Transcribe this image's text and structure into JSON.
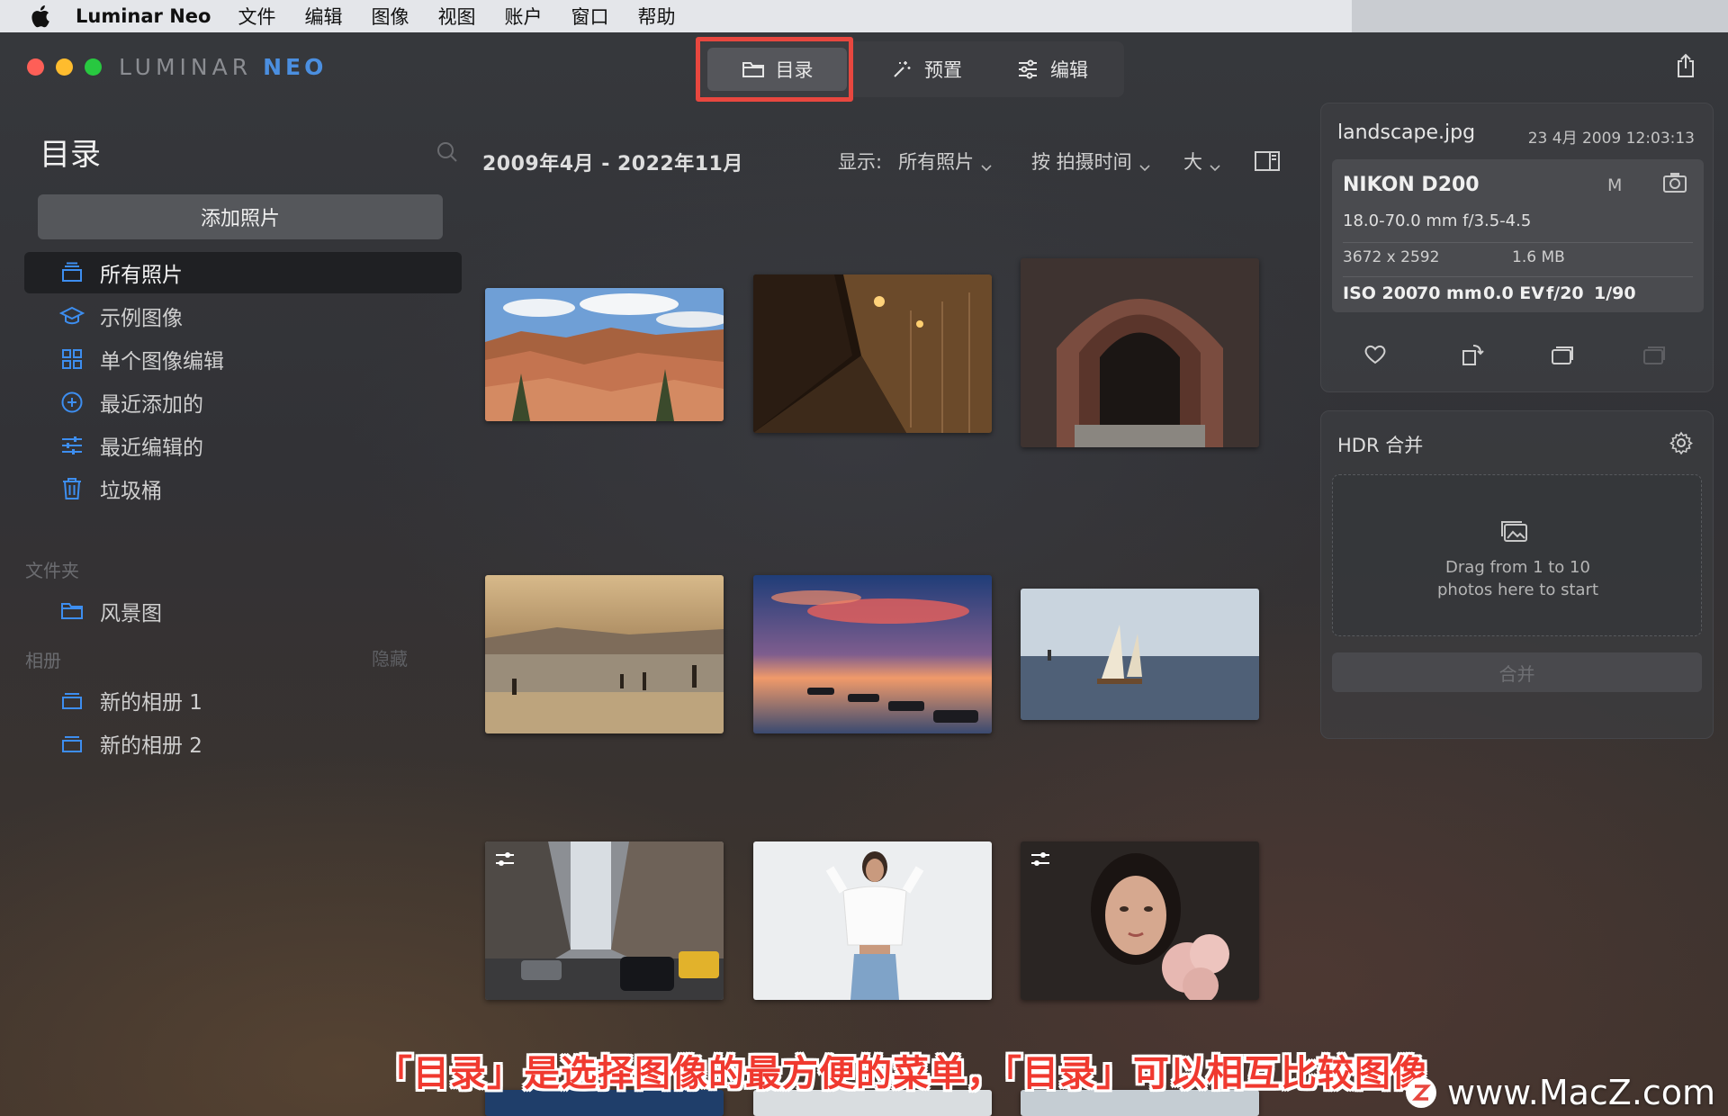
{
  "menubar": {
    "app_name": "Luminar Neo",
    "items": [
      "文件",
      "编辑",
      "图像",
      "视图",
      "账户",
      "窗口",
      "帮助"
    ]
  },
  "brand": {
    "part1": "LUMINAR",
    "part2": "NEO"
  },
  "mode_tabs": {
    "catalog": "目录",
    "presets": "预置",
    "edit": "编辑"
  },
  "sidebar": {
    "title": "目录",
    "add_photos": "添加照片",
    "items": [
      {
        "label": "所有照片",
        "icon": "stack-icon"
      },
      {
        "label": "示例图像",
        "icon": "graduation-cap-icon"
      },
      {
        "label": "单个图像编辑",
        "icon": "grid-icon"
      },
      {
        "label": "最近添加的",
        "icon": "plus-circle-icon"
      },
      {
        "label": "最近编辑的",
        "icon": "sliders-icon"
      },
      {
        "label": "垃圾桶",
        "icon": "trash-icon"
      }
    ],
    "folders_label": "文件夹",
    "folders": [
      {
        "label": "风景图",
        "icon": "folder-icon"
      }
    ],
    "albums_label": "相册",
    "albums_hide": "隐藏",
    "albums": [
      {
        "label": "新的相册 1",
        "icon": "album-icon"
      },
      {
        "label": "新的相册 2",
        "icon": "album-icon"
      }
    ]
  },
  "grid": {
    "date_range": "2009年4月 - 2022年11月",
    "show_label": "显示:",
    "show_value": "所有照片",
    "sort_value": "按 拍摄时间",
    "size_value": "大"
  },
  "info": {
    "filename": "landscape.jpg",
    "date": "23 4月 2009 12:03:13",
    "camera": "NIKON D200",
    "mode": "M",
    "lens": "18.0-70.0 mm f/3.5-4.5",
    "resolution": "3672 x 2592",
    "size": "1.6 MB",
    "iso": "ISO 200",
    "focal": "70 mm",
    "ev": "0.0 EV",
    "aperture": "f/20",
    "shutter": "1/90"
  },
  "hdr": {
    "title": "HDR 合并",
    "drop_line1": "Drag from 1 to 10",
    "drop_line2": "photos here to start",
    "merge": "合并"
  },
  "overlay": {
    "subtitle": "「目录」是选择图像的最方便的菜单，「目录」可以相互比较图像",
    "watermark": "www.MacZ.com"
  },
  "colors": {
    "accent_blue": "#3d8ef0",
    "highlight_red": "#e8473f"
  }
}
